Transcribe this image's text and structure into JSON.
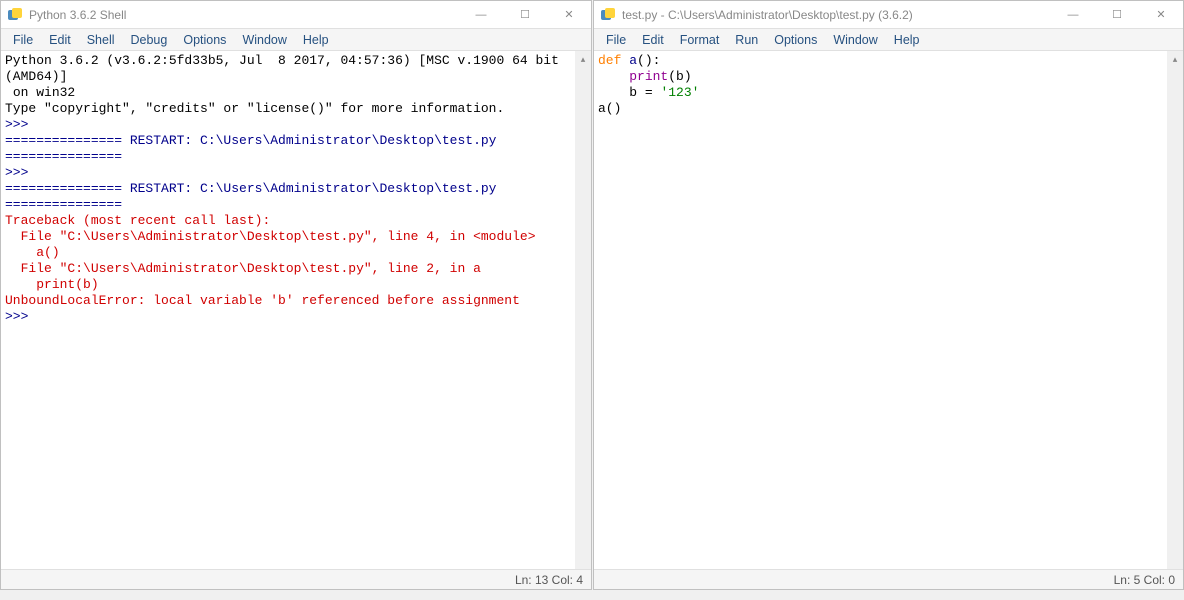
{
  "left_window": {
    "title": "Python 3.6.2 Shell",
    "menu": [
      "File",
      "Edit",
      "Shell",
      "Debug",
      "Options",
      "Window",
      "Help"
    ],
    "lines": [
      {
        "text": "Python 3.6.2 (v3.6.2:5fd33b5, Jul  8 2017, 04:57:36) [MSC v.1900 64 bit (AMD64)]",
        "cls": ""
      },
      {
        "text": " on win32",
        "cls": ""
      },
      {
        "text": "Type \"copyright\", \"credits\" or \"license()\" for more information.",
        "cls": ""
      },
      {
        "text": ">>> ",
        "cls": "kw-dblue"
      },
      {
        "text": "=============== RESTART: C:\\Users\\Administrator\\Desktop\\test.py ===============",
        "cls": "kw-dblue"
      },
      {
        "text": ">>> ",
        "cls": "kw-dblue"
      },
      {
        "text": "=============== RESTART: C:\\Users\\Administrator\\Desktop\\test.py ===============",
        "cls": "kw-dblue"
      },
      {
        "text": "Traceback (most recent call last):",
        "cls": "err-red"
      },
      {
        "text": "  File \"C:\\Users\\Administrator\\Desktop\\test.py\", line 4, in <module>",
        "cls": "err-red"
      },
      {
        "text": "    a()",
        "cls": "err-red"
      },
      {
        "text": "  File \"C:\\Users\\Administrator\\Desktop\\test.py\", line 2, in a",
        "cls": "err-red"
      },
      {
        "text": "    print(b)",
        "cls": "err-red"
      },
      {
        "text": "UnboundLocalError: local variable 'b' referenced before assignment",
        "cls": "err-red"
      },
      {
        "text": ">>> ",
        "cls": "kw-dblue"
      }
    ],
    "status": "Ln: 13  Col: 4"
  },
  "right_window": {
    "title": "test.py - C:\\Users\\Administrator\\Desktop\\test.py (3.6.2)",
    "menu": [
      "File",
      "Edit",
      "Format",
      "Run",
      "Options",
      "Window",
      "Help"
    ],
    "code": {
      "def": "def",
      "fn": " a",
      "paren1": "():",
      "indent_print": "    ",
      "print": "print",
      "print_arg": "(b)",
      "indent_b": "    b = ",
      "str": "'123'",
      "call": "a()"
    },
    "status": "Ln: 5  Col: 0"
  },
  "win_controls": {
    "min": "—",
    "max": "☐",
    "close": "✕"
  }
}
